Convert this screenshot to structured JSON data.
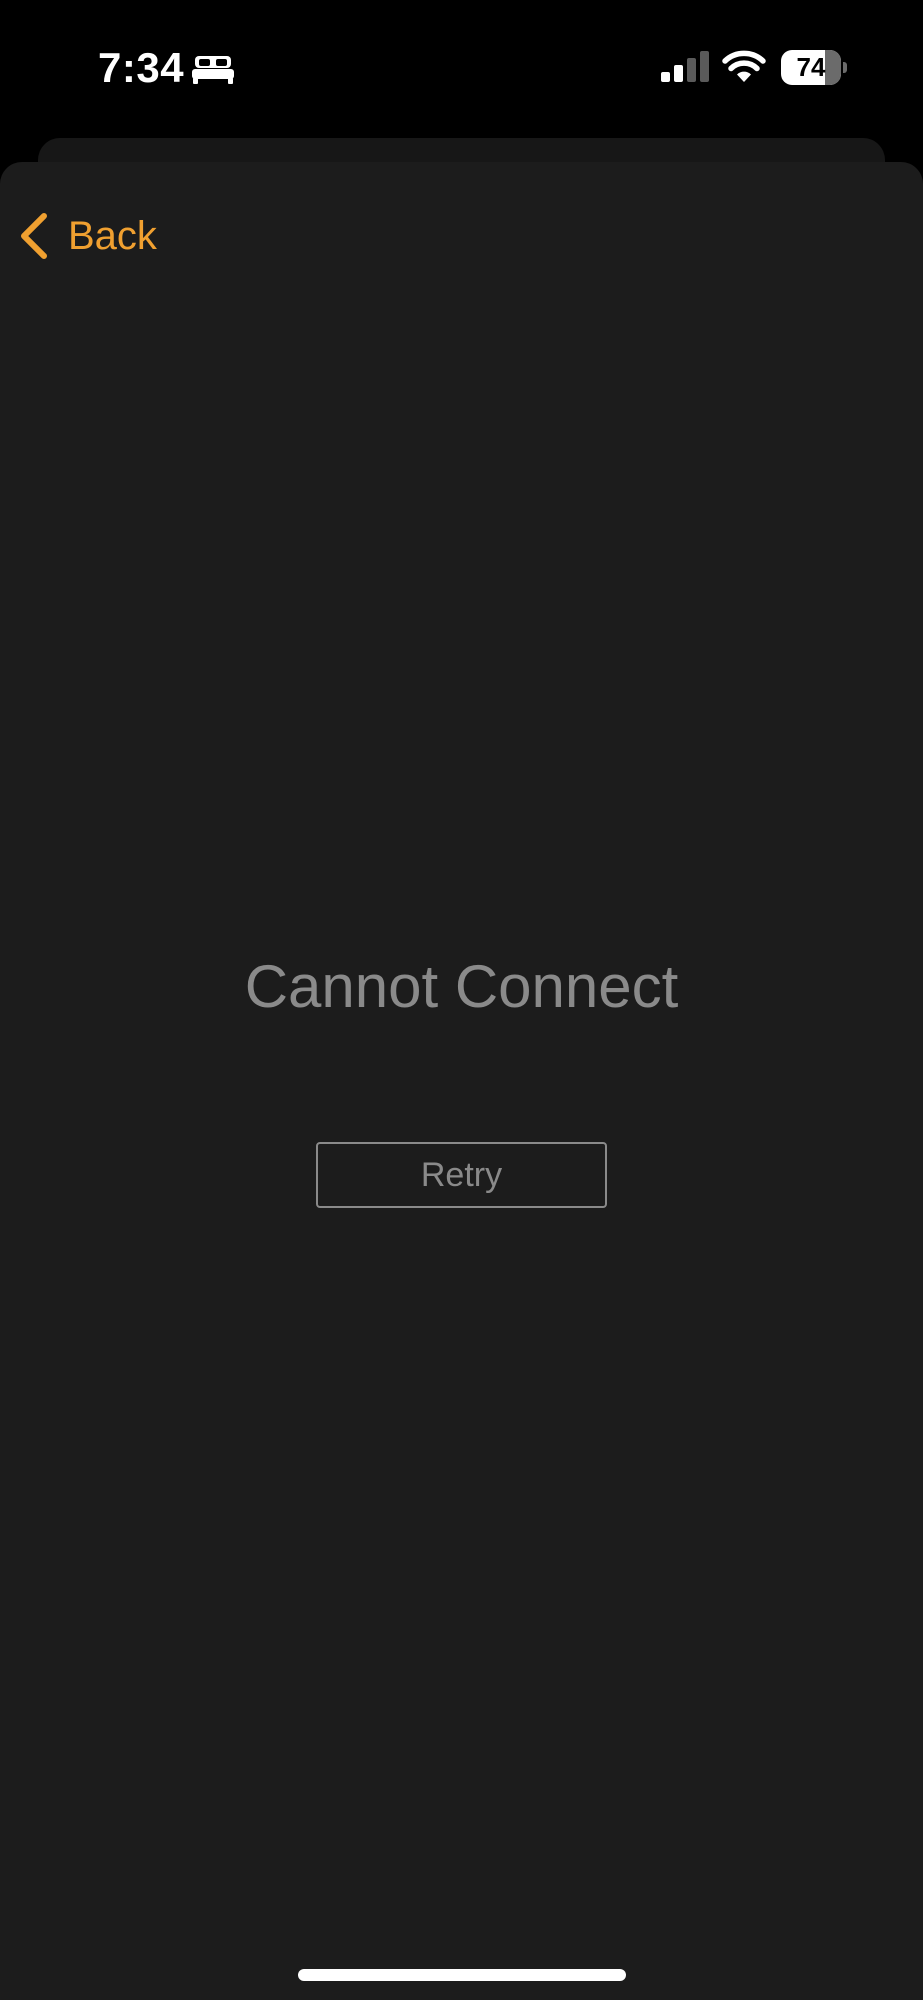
{
  "status_bar": {
    "time": "7:34",
    "focus_icon": "bed-icon",
    "signal_icon": "cellular-signal-icon",
    "signal_bars_active": 2,
    "signal_bars_total": 4,
    "wifi_icon": "wifi-icon",
    "battery_level": "74",
    "battery_fraction": 0.74
  },
  "nav": {
    "back_label": "Back",
    "back_icon": "chevron-left-icon"
  },
  "content": {
    "message": "Cannot Connect",
    "retry_label": "Retry"
  },
  "colors": {
    "accent": "#f0a030",
    "background": "#1c1c1c",
    "muted_text": "#8a8a8a",
    "status_bar_bg": "#000000"
  }
}
